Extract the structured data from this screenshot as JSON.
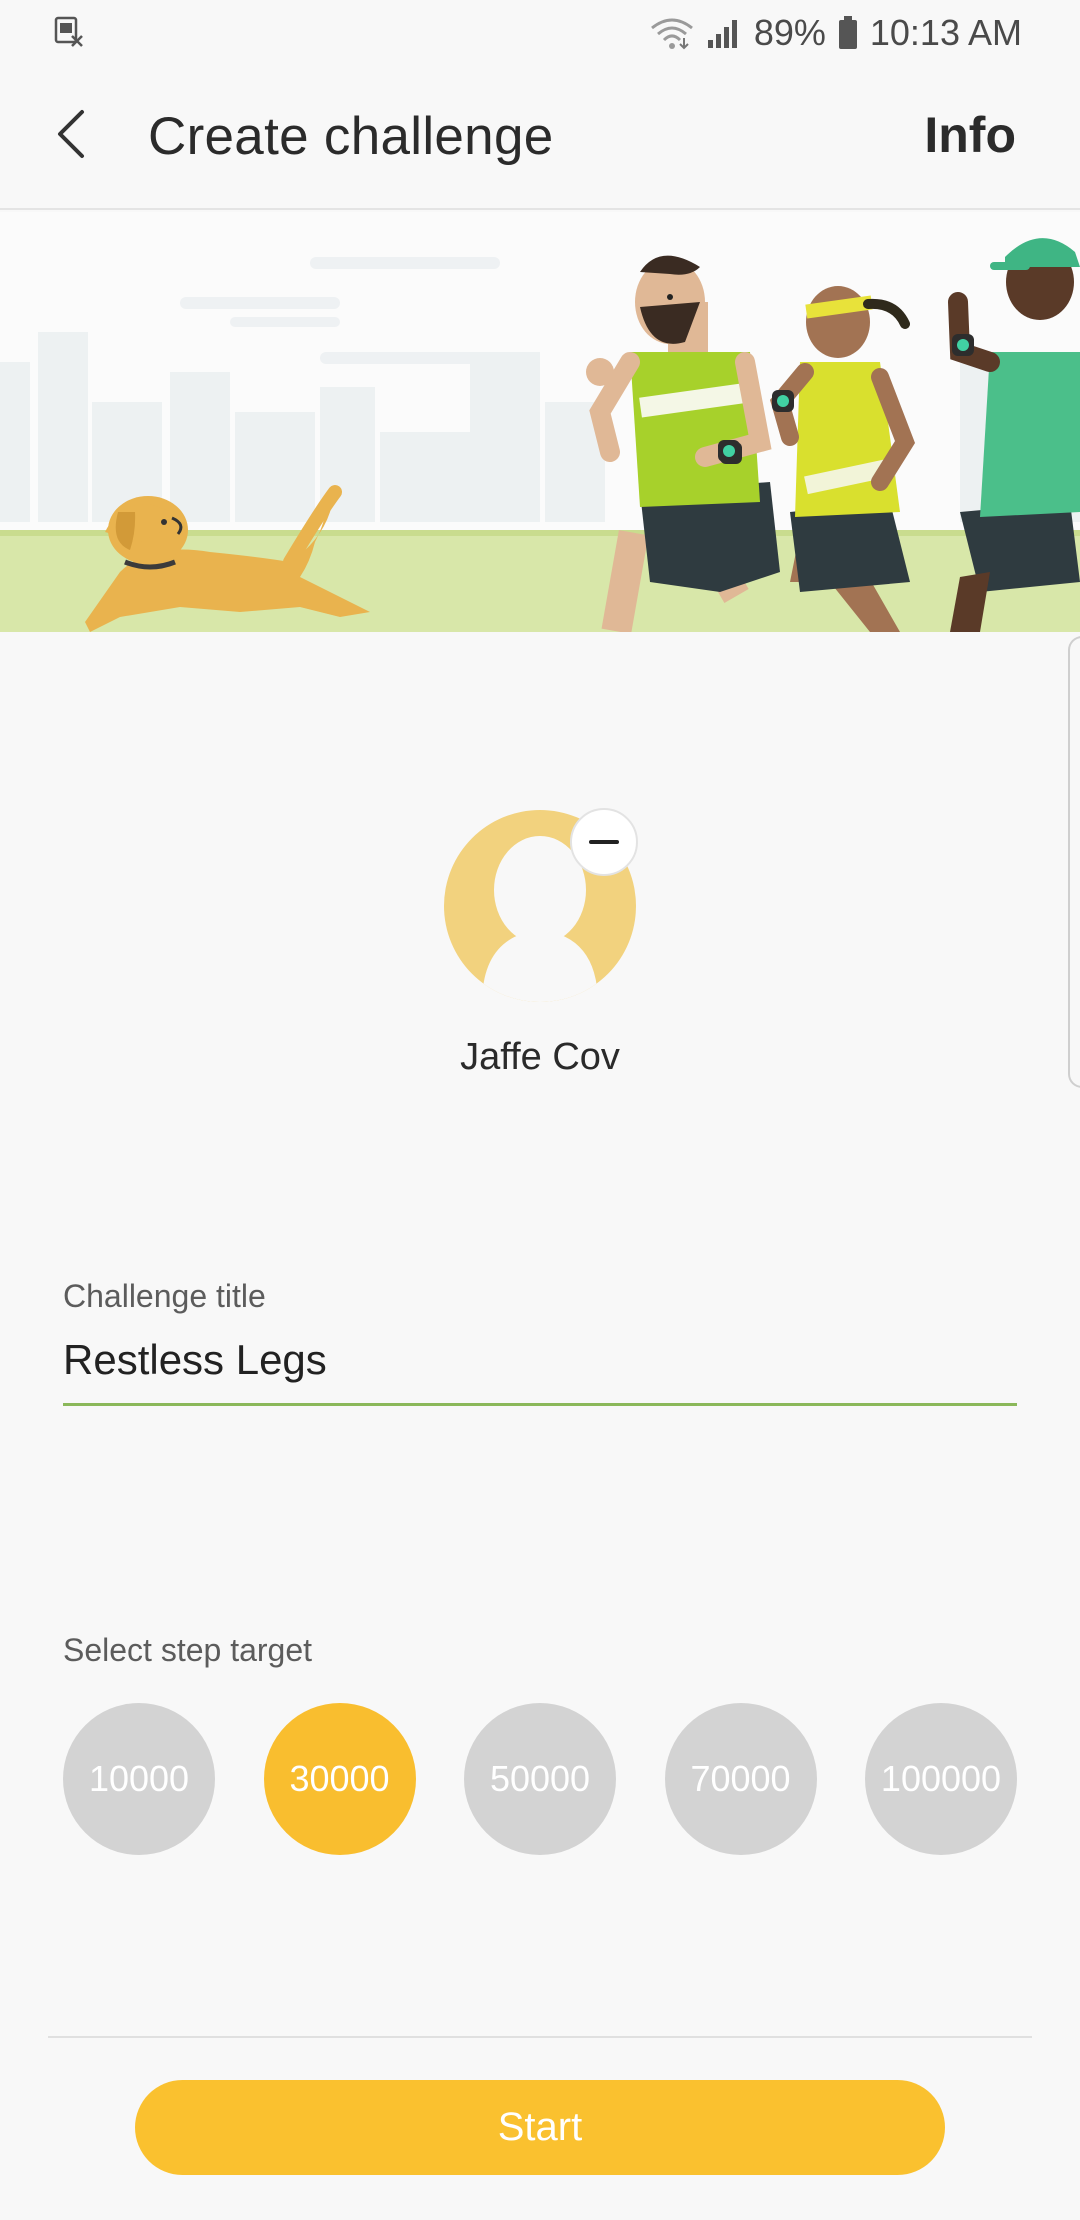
{
  "status_bar": {
    "notification_icon": "sim-card-off-icon",
    "wifi_icon": "wifi-icon",
    "signal_icon": "signal-icon",
    "battery_percent": "89%",
    "battery_icon": "battery-icon",
    "time": "10:13 AM"
  },
  "app_bar": {
    "back_icon": "back-arrow-icon",
    "title": "Create challenge",
    "info_label": "Info"
  },
  "banner": {
    "illustration": "runners-and-dog-illustration"
  },
  "participant": {
    "name": "Jaffe Cov",
    "avatar_icon": "person-silhouette-icon",
    "remove_icon": "minus-icon"
  },
  "challenge_title": {
    "label": "Challenge title",
    "value": "Restless Legs"
  },
  "step_target": {
    "label": "Select step target",
    "options": [
      "10000",
      "30000",
      "50000",
      "70000",
      "100000"
    ],
    "selected": "30000"
  },
  "start_label": "Start",
  "colors": {
    "accent": "#fac12f",
    "unselected": "#d3d3d3",
    "avatar": "#f2d27e",
    "input_underline": "#8bb85a"
  }
}
